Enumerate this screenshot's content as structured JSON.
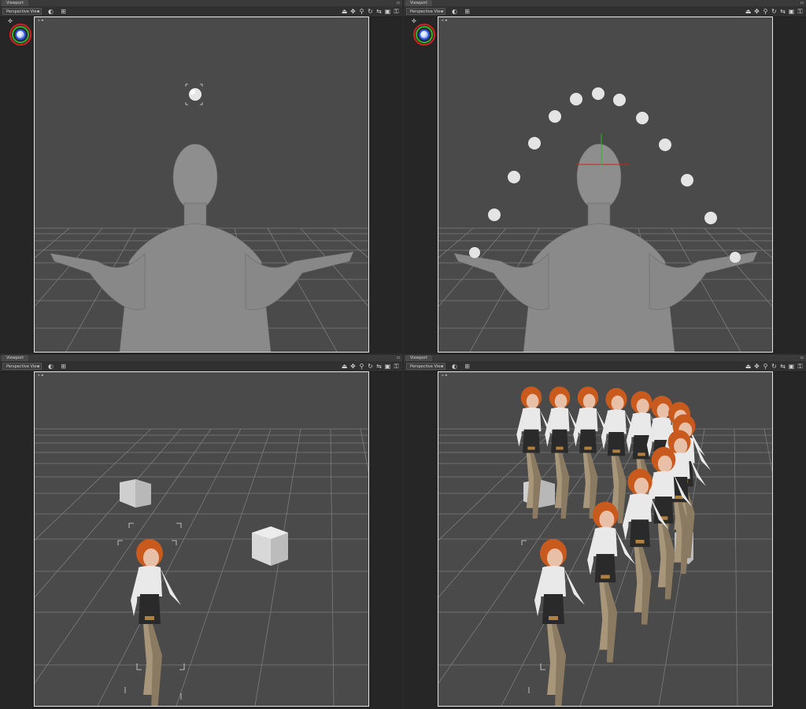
{
  "panes": [
    {
      "id": "top-left",
      "tab_label": "Viewport",
      "view_select": "Perspective View",
      "vp_label": "⁎ ◂"
    },
    {
      "id": "top-right",
      "tab_label": "Viewport",
      "view_select": "Perspective View",
      "vp_label": "⁎ ◂"
    },
    {
      "id": "bottom-left",
      "tab_label": "Viewport",
      "view_select": "Perspective View",
      "vp_label": "⁎ ◂"
    },
    {
      "id": "bottom-right",
      "tab_label": "Viewport",
      "view_select": "Perspective View",
      "vp_label": "⁎ ◂"
    }
  ],
  "toolbar_icons": [
    "camera-orbit-icon",
    "pan-icon",
    "zoom-icon",
    "rotate-icon",
    "dolly-icon",
    "frame-icon",
    "lock-icon"
  ],
  "colors": {
    "grid": "#7a7a7a",
    "floor": "#4a4a4a",
    "skin": "#8e8e8e",
    "sphere": "#e8e8e8",
    "hair": "#c85a1e",
    "axis_red": "#d02020",
    "axis_green": "#20c020"
  }
}
